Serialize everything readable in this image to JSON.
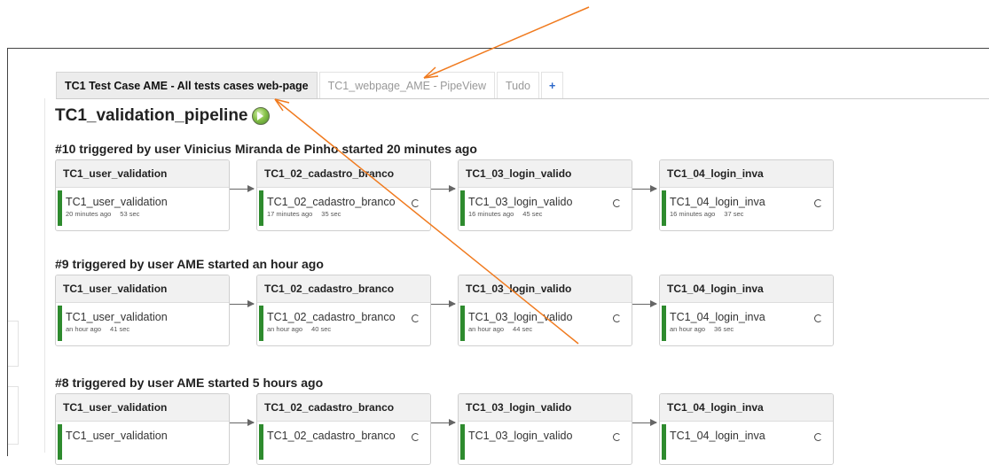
{
  "tabs": [
    {
      "label": "TC1 Test Case AME - All tests cases web-page",
      "active": true
    },
    {
      "label": "TC1_webpage_AME - PipeView",
      "active": false
    },
    {
      "label": "Tudo",
      "active": false
    },
    {
      "label": "+",
      "active": false
    }
  ],
  "pipeline": {
    "title": "TC1_validation_pipeline",
    "icon": "run-pipeline-icon",
    "runs": [
      {
        "heading": "#10 triggered by user Vinicius Miranda de Pinho started 20 minutes ago",
        "jobs": [
          {
            "title": "TC1_user_validation",
            "name": "TC1_user_validation",
            "time": "20 minutes ago",
            "duration": "53 sec",
            "status_color": "#2e8b2e"
          },
          {
            "title": "TC1_02_cadastro_branco",
            "name": "TC1_02_cadastro_branco",
            "time": "17 minutes ago",
            "duration": "35 sec",
            "status_color": "#2e8b2e"
          },
          {
            "title": "TC1_03_login_valido",
            "name": "TC1_03_login_valido",
            "time": "16 minutes ago",
            "duration": "45 sec",
            "status_color": "#2e8b2e"
          },
          {
            "title": "TC1_04_login_inva",
            "name": "TC1_04_login_inva",
            "time": "16 minutes ago",
            "duration": "37 sec",
            "status_color": "#2e8b2e"
          }
        ]
      },
      {
        "heading": "#9 triggered by user AME started an hour ago",
        "jobs": [
          {
            "title": "TC1_user_validation",
            "name": "TC1_user_validation",
            "time": "an hour ago",
            "duration": "41 sec",
            "status_color": "#2e8b2e"
          },
          {
            "title": "TC1_02_cadastro_branco",
            "name": "TC1_02_cadastro_branco",
            "time": "an hour ago",
            "duration": "40 sec",
            "status_color": "#2e8b2e"
          },
          {
            "title": "TC1_03_login_valido",
            "name": "TC1_03_login_valido",
            "time": "an hour ago",
            "duration": "44 sec",
            "status_color": "#2e8b2e"
          },
          {
            "title": "TC1_04_login_inva",
            "name": "TC1_04_login_inva",
            "time": "an hour ago",
            "duration": "36 sec",
            "status_color": "#2e8b2e"
          }
        ]
      },
      {
        "heading": "#8 triggered by user AME started 5 hours ago",
        "jobs": [
          {
            "title": "TC1_user_validation",
            "name": "TC1_user_validation",
            "time": "",
            "duration": "",
            "status_color": "#2e8b2e"
          },
          {
            "title": "TC1_02_cadastro_branco",
            "name": "TC1_02_cadastro_branco",
            "time": "",
            "duration": "",
            "status_color": "#2e8b2e"
          },
          {
            "title": "TC1_03_login_valido",
            "name": "TC1_03_login_valido",
            "time": "",
            "duration": "",
            "status_color": "#2e8b2e"
          },
          {
            "title": "TC1_04_login_inva",
            "name": "TC1_04_login_inva",
            "time": "",
            "duration": "",
            "status_color": "#2e8b2e"
          }
        ]
      }
    ]
  },
  "colors": {
    "annotation": "#f07a1e",
    "success": "#2e8b2e",
    "tab_add": "#2a67c9"
  }
}
